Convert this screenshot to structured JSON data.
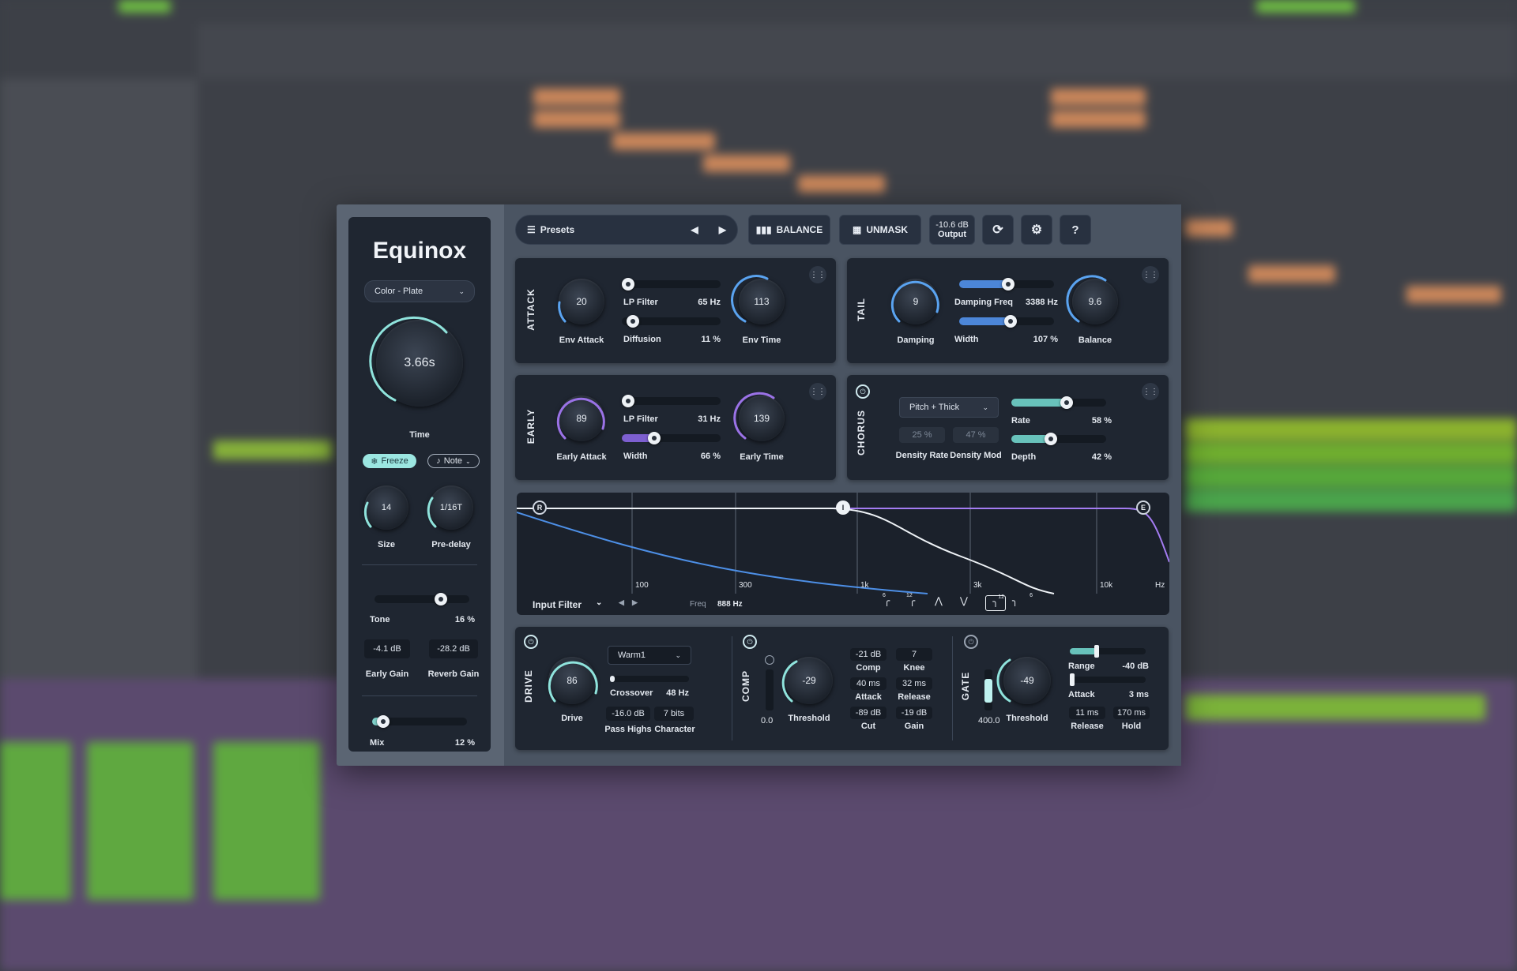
{
  "daw": {},
  "plugin": {
    "name": "Equinox",
    "algorithm": "Color - Plate",
    "time_value": "3.66s",
    "time_label": "Time",
    "freeze_label": "Freeze",
    "note_label": "Note",
    "size_value": "14",
    "size_label": "Size",
    "predelay_value": "1/16T",
    "predelay_label": "Pre-delay",
    "tone_label": "Tone",
    "tone_value": "16 %",
    "tone_level": 0.7,
    "early_gain_value": "-4.1 dB",
    "early_gain_label": "Early Gain",
    "reverb_gain_value": "-28.2 dB",
    "reverb_gain_label": "Reverb Gain",
    "mix_label": "Mix",
    "mix_value": "12 %",
    "mix_level": 0.12
  },
  "topbar": {
    "presets_label": "Presets",
    "balance_label": "BALANCE",
    "unmask_label": "UNMASK",
    "output_value": "-10.6 dB",
    "output_label": "Output",
    "help_label": "?"
  },
  "attack": {
    "section_label": "ATTACK",
    "env_attack_value": "20",
    "env_attack_label": "Env Attack",
    "lp_filter_label": "LP Filter",
    "lp_filter_value": "65 Hz",
    "lp_filter_level": 0.05,
    "diffusion_label": "Diffusion",
    "diffusion_value": "11 %",
    "diffusion_level": 0.11,
    "env_time_value": "113",
    "env_time_label": "Env Time"
  },
  "tail": {
    "section_label": "TAIL",
    "damping_value": "9",
    "damping_label": "Damping",
    "damping_freq_label": "Damping Freq",
    "damping_freq_value": "3388 Hz",
    "damping_freq_level": 0.52,
    "width_label": "Width",
    "width_value": "107 %",
    "width_level": 0.54,
    "balance_value": "9.6",
    "balance_label": "Balance"
  },
  "early": {
    "section_label": "EARLY",
    "early_attack_value": "89",
    "early_attack_label": "Early Attack",
    "lp_filter_label": "LP Filter",
    "lp_filter_value": "31 Hz",
    "lp_filter_level": 0.03,
    "width_label": "Width",
    "width_value": "66 %",
    "width_level": 0.33,
    "early_time_value": "139",
    "early_time_label": "Early Time"
  },
  "chorus": {
    "section_label": "CHORUS",
    "mode": "Pitch + Thick",
    "density_rate_value": "25 %",
    "density_rate_label": "Density Rate",
    "density_mod_value": "47 %",
    "density_mod_label": "Density Mod",
    "rate_label": "Rate",
    "rate_value": "58 %",
    "rate_level": 0.58,
    "depth_label": "Depth",
    "depth_value": "42 %",
    "depth_level": 0.42
  },
  "filter": {
    "selector": "Input Filter",
    "freq_label": "Freq",
    "freq_value": "888 Hz",
    "axis_labels": [
      "100",
      "300",
      "1k",
      "3k",
      "10k",
      "Hz"
    ],
    "node_labels": [
      "R",
      "I",
      "E"
    ],
    "shape_labels": [
      "6",
      "12",
      "",
      "",
      "12",
      "6"
    ]
  },
  "drive": {
    "section_label": "DRIVE",
    "drive_value": "86",
    "drive_label": "Drive",
    "mode": "Warm1",
    "crossover_label": "Crossover",
    "crossover_value": "48 Hz",
    "crossover_level": 0.02,
    "pass_highs_value": "-16.0 dB",
    "pass_highs_label": "Pass Highs",
    "character_value": "7 bits",
    "character_label": "Character"
  },
  "comp": {
    "section_label": "COMP",
    "meter_value": "0.0",
    "threshold_value": "-29",
    "threshold_label": "Threshold",
    "comp_value": "-21 dB",
    "comp_label": "Comp",
    "knee_value": "7",
    "knee_label": "Knee",
    "attack_value": "40 ms",
    "attack_label": "Attack",
    "release_value": "32 ms",
    "release_label": "Release",
    "cut_value": "-89 dB",
    "cut_label": "Cut",
    "gain_value": "-19 dB",
    "gain_label": "Gain"
  },
  "gate": {
    "section_label": "GATE",
    "meter_value": "400.0",
    "threshold_value": "-49",
    "threshold_label": "Threshold",
    "range_label": "Range",
    "range_value": "-40 dB",
    "range_level": 0.35,
    "attack_label": "Attack",
    "attack_value": "3 ms",
    "attack_level": 0.02,
    "release_value": "11 ms",
    "release_label": "Release",
    "hold_value": "170 ms",
    "hold_label": "Hold"
  }
}
